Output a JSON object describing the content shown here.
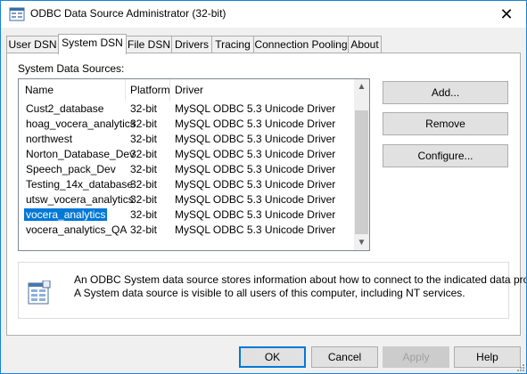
{
  "window": {
    "title": "ODBC Data Source Administrator (32-bit)",
    "close_glyph": "✕"
  },
  "tabs": [
    {
      "label": "User DSN",
      "active": false
    },
    {
      "label": "System DSN",
      "active": true
    },
    {
      "label": "File DSN",
      "active": false
    },
    {
      "label": "Drivers",
      "active": false
    },
    {
      "label": "Tracing",
      "active": false
    },
    {
      "label": "Connection Pooling",
      "active": false
    },
    {
      "label": "About",
      "active": false
    }
  ],
  "system_dsn": {
    "section_label": "System Data Sources:",
    "columns": {
      "name": "Name",
      "platform": "Platform",
      "driver": "Driver"
    },
    "rows": [
      {
        "name": "Cust2_database",
        "platform": "32-bit",
        "driver": "MySQL ODBC 5.3 Unicode Driver",
        "selected": false
      },
      {
        "name": "hoag_vocera_analytics",
        "platform": "32-bit",
        "driver": "MySQL ODBC 5.3 Unicode Driver",
        "selected": false
      },
      {
        "name": "northwest",
        "platform": "32-bit",
        "driver": "MySQL ODBC 5.3 Unicode Driver",
        "selected": false
      },
      {
        "name": "Norton_Database_Dev",
        "platform": "32-bit",
        "driver": "MySQL ODBC 5.3 Unicode Driver",
        "selected": false
      },
      {
        "name": "Speech_pack_Dev",
        "platform": "32-bit",
        "driver": "MySQL ODBC 5.3 Unicode Driver",
        "selected": false
      },
      {
        "name": "Testing_14x_database",
        "platform": "32-bit",
        "driver": "MySQL ODBC 5.3 Unicode Driver",
        "selected": false
      },
      {
        "name": "utsw_vocera_analytics",
        "platform": "32-bit",
        "driver": "MySQL ODBC 5.3 Unicode Driver",
        "selected": false
      },
      {
        "name": "vocera_analytics",
        "platform": "32-bit",
        "driver": "MySQL ODBC 5.3 Unicode Driver",
        "selected": true
      },
      {
        "name": "vocera_analytics_QA",
        "platform": "32-bit",
        "driver": "MySQL ODBC 5.3 Unicode Driver",
        "selected": false
      }
    ],
    "buttons": {
      "add": "Add...",
      "remove": "Remove",
      "configure": "Configure..."
    },
    "info": {
      "line1": "An ODBC System data source stores information about how to connect to the indicated data provider.",
      "line2": "A System data source is visible to all users of this computer, including NT services."
    }
  },
  "footer": {
    "ok": "OK",
    "cancel": "Cancel",
    "apply": "Apply",
    "help": "Help"
  },
  "colors": {
    "selection": "#0078d7",
    "window_border": "#1883d7",
    "face": "#f0f0f0"
  }
}
